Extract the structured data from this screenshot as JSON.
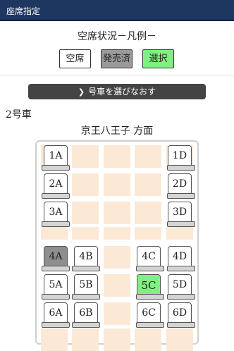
{
  "header": {
    "title": "座席指定"
  },
  "legend": {
    "title": "空席状況－凡例－",
    "empty_label": "空席",
    "sold_label": "発売済",
    "selected_label": "選択"
  },
  "rechoose_button": {
    "label": "号車を選びなおす",
    "icon": "chevron-right-icon"
  },
  "car": {
    "label": "2号車",
    "direction": "京王八王子 方面"
  },
  "colors": {
    "header_bg": "#1e3760",
    "seat_sold": "#8e8e8e",
    "seat_selected": "#80f080",
    "aisle": "#fbe9d6"
  },
  "seats": [
    {
      "label": "1A",
      "status": "available"
    },
    {
      "label": "1D",
      "status": "available"
    },
    {
      "label": "2A",
      "status": "available"
    },
    {
      "label": "2D",
      "status": "available"
    },
    {
      "label": "3A",
      "status": "available"
    },
    {
      "label": "3D",
      "status": "available"
    },
    {
      "label": "4A",
      "status": "sold"
    },
    {
      "label": "4B",
      "status": "available"
    },
    {
      "label": "4C",
      "status": "available"
    },
    {
      "label": "4D",
      "status": "available"
    },
    {
      "label": "5A",
      "status": "available"
    },
    {
      "label": "5B",
      "status": "available"
    },
    {
      "label": "5C",
      "status": "selected"
    },
    {
      "label": "5D",
      "status": "available"
    },
    {
      "label": "6A",
      "status": "available"
    },
    {
      "label": "6B",
      "status": "available"
    },
    {
      "label": "6C",
      "status": "available"
    },
    {
      "label": "6D",
      "status": "available"
    }
  ]
}
